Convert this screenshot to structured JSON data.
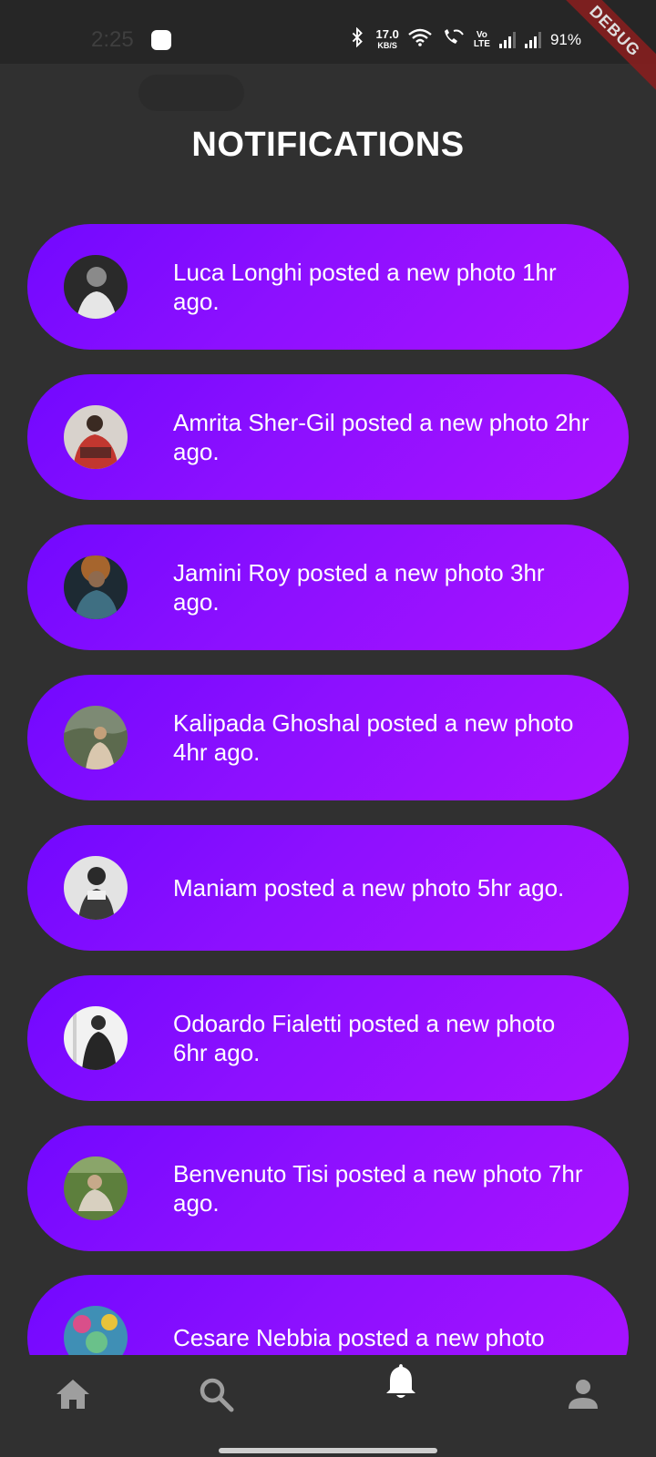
{
  "status_bar": {
    "time": "2:25",
    "net_speed": "17.0",
    "net_unit": "KB/S",
    "volte_top": "Vo",
    "volte_bottom": "LTE",
    "battery": "91%"
  },
  "debug_label": "DEBUG",
  "page_title": "NOTIFICATIONS",
  "notifications": [
    {
      "text": "Luca Longhi posted a new photo 1hr ago.",
      "avatar_color": "#444444"
    },
    {
      "text": "Amrita Sher-Gil  posted a new photo 2hr ago.",
      "avatar_color": "#c8423a"
    },
    {
      "text": "Jamini Roy posted a new photo 3hr ago.",
      "avatar_color": "#2f5e6d"
    },
    {
      "text": "Kalipada Ghoshal posted a new photo 4hr ago.",
      "avatar_color": "#6b7456"
    },
    {
      "text": "Maniam posted a new photo 5hr ago.",
      "avatar_color": "#b9b9b9"
    },
    {
      "text": "Odoardo Fialetti posted a new photo 6hr ago.",
      "avatar_color": "#d9d9d9"
    },
    {
      "text": "Benvenuto Tisi posted a new photo 7hr ago.",
      "avatar_color": "#6f8f4c"
    },
    {
      "text": "Cesare Nebbia posted a new photo",
      "avatar_color": "#4a8fb0"
    }
  ],
  "bottom_nav": {
    "items": [
      {
        "icon": "home-icon",
        "active": false
      },
      {
        "icon": "search-icon",
        "active": false
      },
      {
        "icon": "bell-icon",
        "active": true
      },
      {
        "icon": "person-icon",
        "active": false
      }
    ]
  },
  "colors": {
    "background": "#303030",
    "card_start": "#7208ff",
    "card_end": "#aa12ff",
    "nav_inactive": "#9e9e9e",
    "nav_active": "#ffffff"
  }
}
